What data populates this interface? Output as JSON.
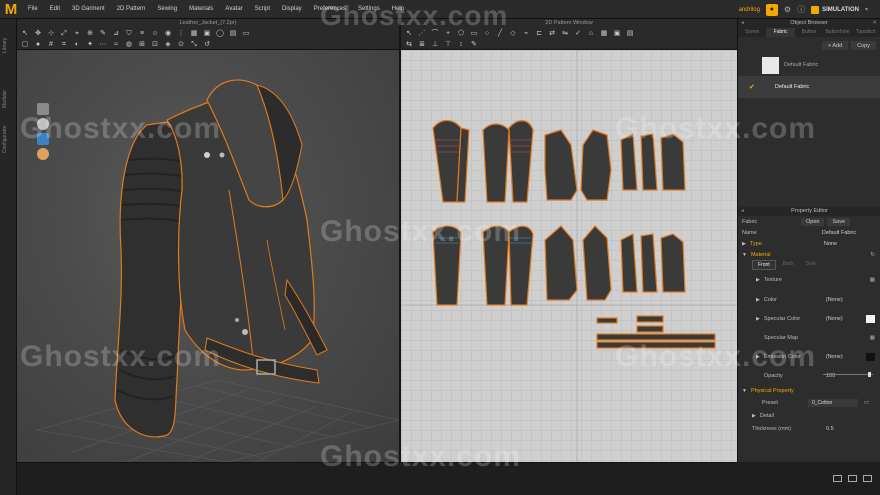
{
  "app": {
    "logo": "M"
  },
  "menu": [
    "File",
    "Edit",
    "3D Garment",
    "2D Pattern",
    "Sewing",
    "Materials",
    "Avatar",
    "Script",
    "Display",
    "Preferences",
    "Settings",
    "Help"
  ],
  "user": {
    "name": "andrilog",
    "mode": "SIMULATION"
  },
  "viewport3d": {
    "file_title": "Leather_Jacket_(7.2pr)"
  },
  "viewport2d": {
    "title": "2D Pattern Window"
  },
  "left_tabs": [
    "Library",
    "Modular",
    "Configurator"
  ],
  "object_browser": {
    "title": "Object Browser",
    "tabs": [
      "Scene",
      "Fabric",
      "Button",
      "Buttonhole",
      "Topstitch"
    ],
    "active_tab": "Fabric",
    "add_label": "+ Add",
    "copy_label": "Copy",
    "fabrics": [
      {
        "name": "Default Fabric",
        "selected": false
      },
      {
        "name": "Default Fabric",
        "selected": true
      }
    ]
  },
  "property_editor": {
    "title": "Property Editor",
    "fabric_label": "Fabric",
    "open_label": "Open",
    "save_label": "Save",
    "name_label": "Name",
    "name_value": "Default Fabric",
    "type_label": "Type",
    "type_value": "None",
    "material_label": "Material",
    "subtabs": [
      "Front",
      "Back",
      "Side"
    ],
    "texture_label": "Texture",
    "color_label": "Color",
    "color_value": "(None)",
    "specular_color_label": "Specular Color",
    "specular_color_value": "(None)",
    "specular_map_label": "Specular Map",
    "emission_color_label": "Emission Color",
    "emission_color_value": "(None)",
    "opacity_label": "Opacity",
    "opacity_value": "100",
    "physical_label": "Physical Property",
    "preset_label": "Preset",
    "preset_value": "0_Cotton",
    "detail_label": "Detail",
    "thickness_label": "Thickness (mm)",
    "thickness_value": "0.5"
  },
  "watermark": "Ghostxx.com",
  "colors": {
    "accent": "#f2a900",
    "seam": "#e07a1c",
    "leather": "#3a3a3a"
  }
}
